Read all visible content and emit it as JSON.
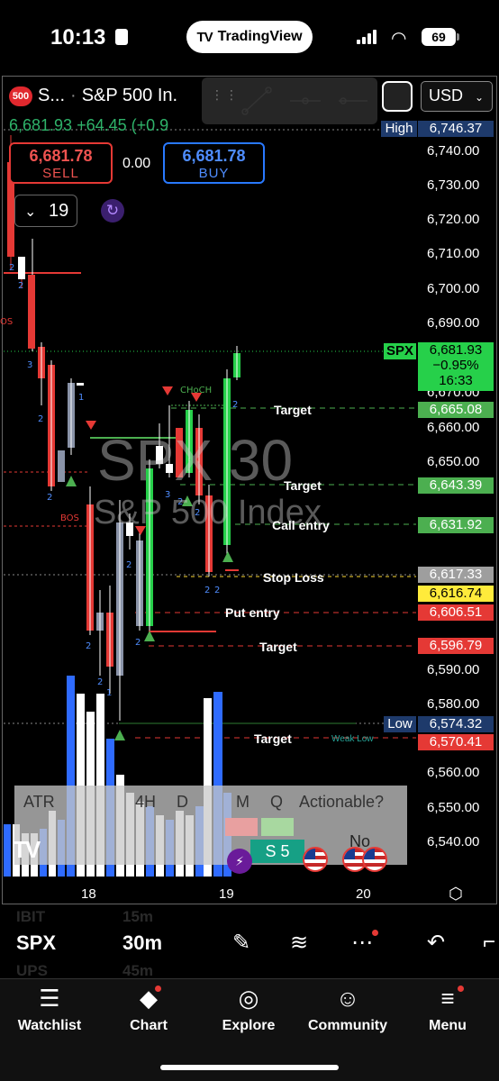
{
  "status_bar": {
    "time": "10:13",
    "app_pill": "TradingView",
    "battery": "69"
  },
  "symbol_header": {
    "badge": "500",
    "ticker_short": "S...",
    "name": "S&P 500 In.",
    "quote_line": "6,681.93 +64.45 (+0.9",
    "currency": "USD"
  },
  "trade": {
    "sell_price": "6,681.78",
    "sell_label": "SELL",
    "spread": "0.00",
    "buy_price": "6,681.78",
    "buy_label": "BUY"
  },
  "interval_selector": "19",
  "watermark": {
    "main": "SPX  30",
    "sub": "S&P 500 Index"
  },
  "price_axis": [
    "6,740.00",
    "6,730.00",
    "6,720.00",
    "6,710.00",
    "6,700.00",
    "6,690.00",
    "6,670.00",
    "6,660.00",
    "6,650.00",
    "6,590.00",
    "6,580.00",
    "6,560.00",
    "6,550.00",
    "6,540.00"
  ],
  "price_tags": {
    "high_label": "High",
    "high_value": "6,746.37",
    "spx_label": "SPX",
    "spx_price": "6,681.93",
    "spx_change": "−0.95%",
    "spx_countdown": "16:33",
    "target1": "6,665.08",
    "target2": "6,643.39",
    "call_entry": "6,631.92",
    "stop_loss": "6,617.33",
    "yellow": "6,616.74",
    "put_entry": "6,606.51",
    "target3": "6,596.79",
    "low_label": "Low",
    "low_value": "6,574.32",
    "target4": "6,570.41"
  },
  "levels": {
    "target": "Target",
    "call_entry": "Call entry",
    "stop_loss": "Stop Loss",
    "put_entry": "Put entry",
    "weak_low": "Weak Low",
    "choch": "CHoCH",
    "bos": "BOS",
    "bos_top": "OS"
  },
  "mtf_table": {
    "headers": [
      "ATR",
      "4H",
      "D",
      "M",
      "Q",
      "Actionable?"
    ],
    "actionable": "No",
    "s_value": "S 5"
  },
  "x_axis": [
    "18",
    "19",
    "20"
  ],
  "bottom_toolbar": {
    "ghost_above": "IBIT",
    "ghost_above_val": "15m",
    "symbol": "SPX",
    "interval": "30m",
    "ghost_below": "UPS",
    "ghost_below_val": "45m"
  },
  "tabs": [
    {
      "label": "Watchlist",
      "icon": "watchlist-icon"
    },
    {
      "label": "Chart",
      "icon": "chart-icon"
    },
    {
      "label": "Explore",
      "icon": "compass-icon"
    },
    {
      "label": "Community",
      "icon": "community-icon"
    },
    {
      "label": "Menu",
      "icon": "menu-icon"
    }
  ],
  "colors": {
    "up": "#26d04a",
    "down": "#e53935",
    "grey_candle": "#8a93a8",
    "volume_blue": "#2f6bff",
    "target_green": "#4caf50",
    "red_tag": "#e53935"
  }
}
